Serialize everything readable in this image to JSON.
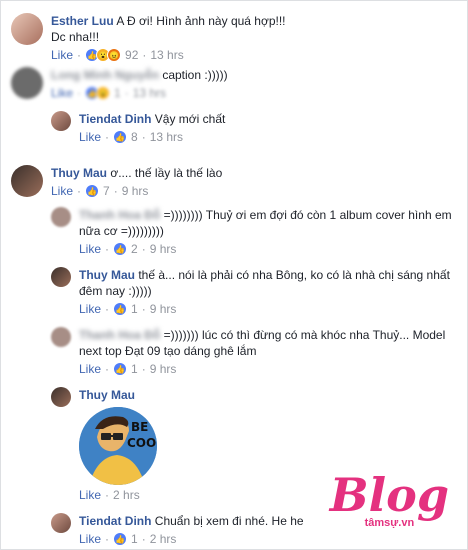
{
  "comments": [
    {
      "name": "Esther Luu",
      "text": "A Đ ơi! Hình ảnh này quá hợp!!!",
      "text2": "Dc nha!!!",
      "like": "Like",
      "count": "92",
      "time": "13 hrs"
    },
    {
      "name": "Long Minh Nguyễn",
      "text": "caption :)))))",
      "like": "Like",
      "count": "1",
      "time": "13 hrs"
    },
    {
      "name": "Tiendat Dinh",
      "text": "Vậy mới chất",
      "like": "Like",
      "count": "8",
      "time": "13 hrs"
    },
    {
      "name": "Thuy Mau",
      "text": "ơ.... thế lầy là thế lào",
      "like": "Like",
      "count": "7",
      "time": "9 hrs"
    },
    {
      "name": "Thanh Hoa Đỗ",
      "text": "=)))))))) Thuỷ ơi em đợi đó còn 1 album cover hình em",
      "text2": "nữa cơ =)))))))))",
      "like": "Like",
      "count": "2",
      "time": "9 hrs"
    },
    {
      "name": "Thuy Mau",
      "text": "thế à... nói là phải có nha Bông, ko có là nhà chị sáng nhất",
      "text2": "đêm nay :)))))",
      "like": "Like",
      "count": "1",
      "time": "9 hrs"
    },
    {
      "name": "Thanh Hoa Đỗ",
      "text": "=))))))) lúc có thì đừng có mà khóc nha Thuỷ... Model",
      "text2": "next top Đạt 09 tạo dáng ghê lắm",
      "like": "Like",
      "count": "1",
      "time": "9 hrs"
    },
    {
      "name": "Thuy Mau",
      "sticker_text": "BE COOL!",
      "like": "Like",
      "time": "2 hrs"
    },
    {
      "name": "Tiendat Dinh",
      "text": "Chuẩn bị xem đi nhé. He he",
      "like": "Like",
      "count": "1",
      "time": "2 hrs"
    }
  ],
  "watermark": {
    "logo": "Blog",
    "sub": "tâmsự.vn"
  },
  "colors": {
    "link": "#365899",
    "meta": "#90949c",
    "like": "#4267b2",
    "brand": "#e4317f"
  }
}
